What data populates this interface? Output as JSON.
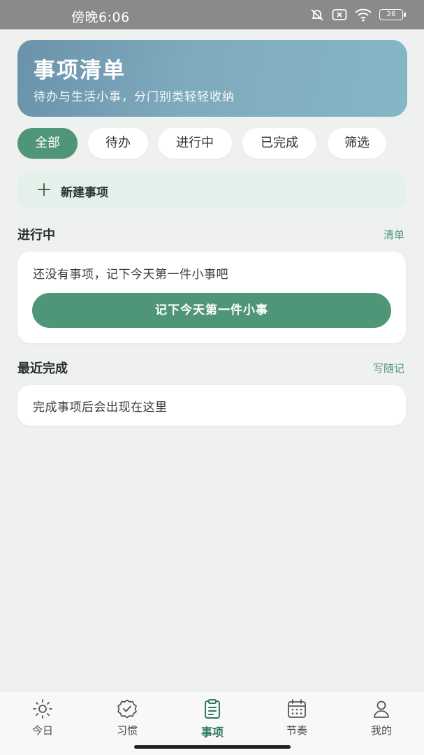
{
  "status_bar": {
    "time": "傍晚6:06",
    "battery": "26"
  },
  "header": {
    "title": "事项清单",
    "subtitle": "待办与生活小事，分门别类轻轻收纳"
  },
  "filters": {
    "items": [
      {
        "label": "全部",
        "active": true
      },
      {
        "label": "待办",
        "active": false
      },
      {
        "label": "进行中",
        "active": false
      },
      {
        "label": "已完成",
        "active": false
      },
      {
        "label": "筛选",
        "active": false
      }
    ]
  },
  "new_item": {
    "icon": "plus-icon",
    "label": "新建事项"
  },
  "in_progress": {
    "title": "进行中",
    "link": "清单",
    "empty_text": "还没有事项，记下今天第一件小事吧",
    "button_label": "记下今天第一件小事"
  },
  "recent_done": {
    "title": "最近完成",
    "link": "写随记",
    "empty_text": "完成事项后会出现在这里"
  },
  "bottom_nav": {
    "items": [
      {
        "label": "今日",
        "icon": "sun-icon",
        "active": false
      },
      {
        "label": "习惯",
        "icon": "check-badge-icon",
        "active": false
      },
      {
        "label": "事项",
        "icon": "clipboard-icon",
        "active": true
      },
      {
        "label": "节奏",
        "icon": "calendar-icon",
        "active": false
      },
      {
        "label": "我的",
        "icon": "user-icon",
        "active": false
      }
    ]
  },
  "colors": {
    "accent": "#4f9577",
    "header_start": "#6a93ab",
    "header_end": "#84b6c6",
    "background": "#eef1ef"
  }
}
